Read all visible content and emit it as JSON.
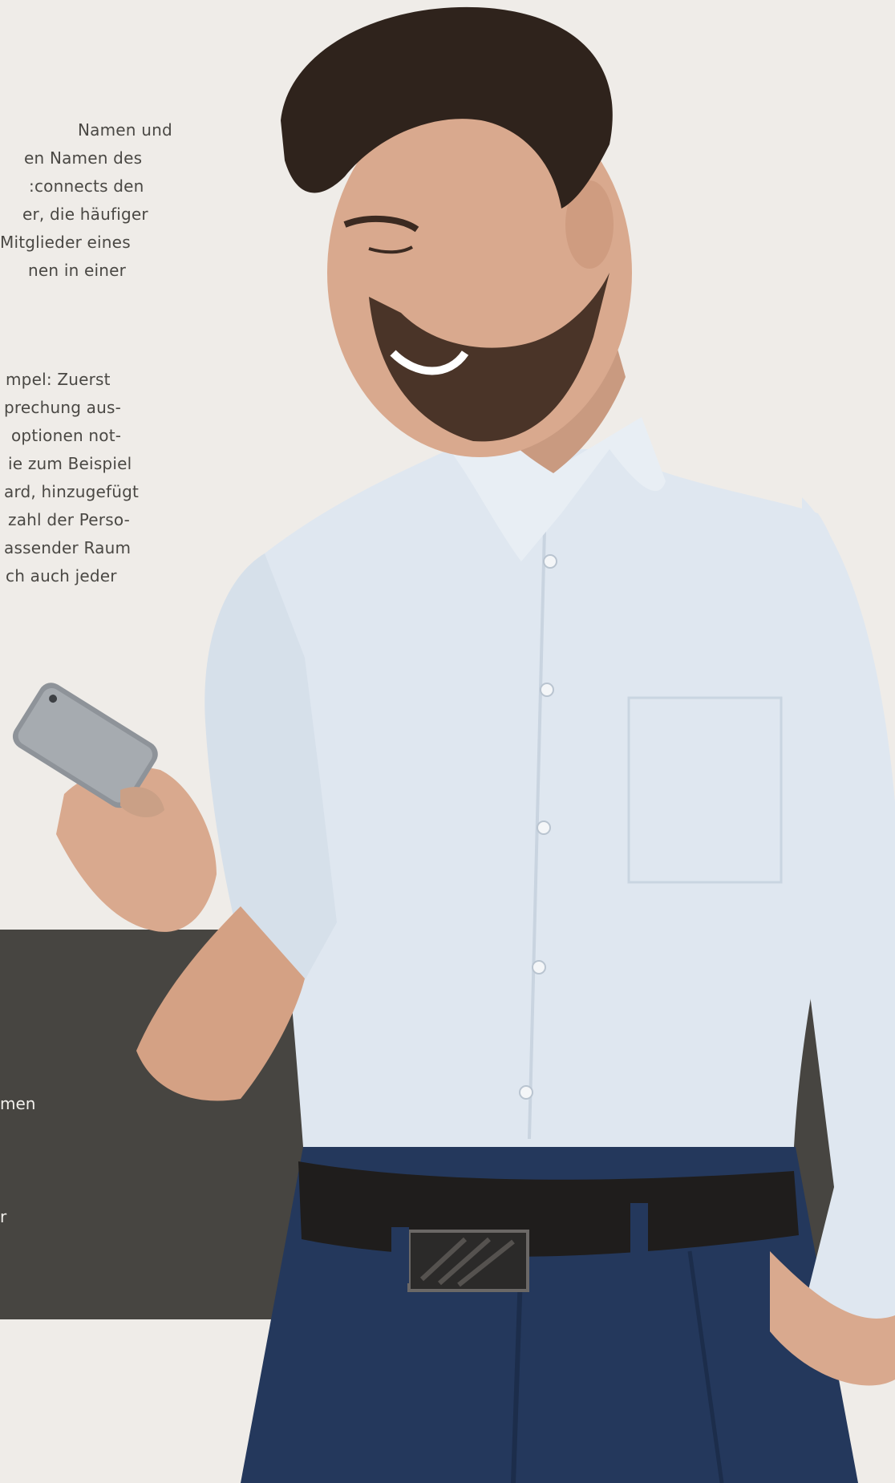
{
  "text_block_1": {
    "lines": [
      "Namen und",
      "en Namen des",
      ":connects den",
      "er, die häufiger",
      "Mitglieder eines",
      "nen in einer"
    ]
  },
  "text_block_2": {
    "lines": [
      "mpel: Zuerst",
      "prechung aus-",
      "optionen not-",
      "ie zum Beispiel",
      "ard, hinzugefügt",
      "zahl der Perso-",
      "assender Raum",
      "ch auch jeder"
    ]
  },
  "dark_band": {
    "lines": [
      "men",
      "r"
    ]
  },
  "colors": {
    "page_background": "#efece8",
    "band_background": "#474541",
    "body_text": "#4a4844",
    "band_text": "#f2f0ec",
    "shirt": "#dfe8f1",
    "trousers": "#24385c",
    "belt": "#1f1d1c",
    "hair": "#2f231c",
    "skin": "#d9a98e"
  },
  "photo": {
    "subject": "man-looking-at-smartphone"
  }
}
